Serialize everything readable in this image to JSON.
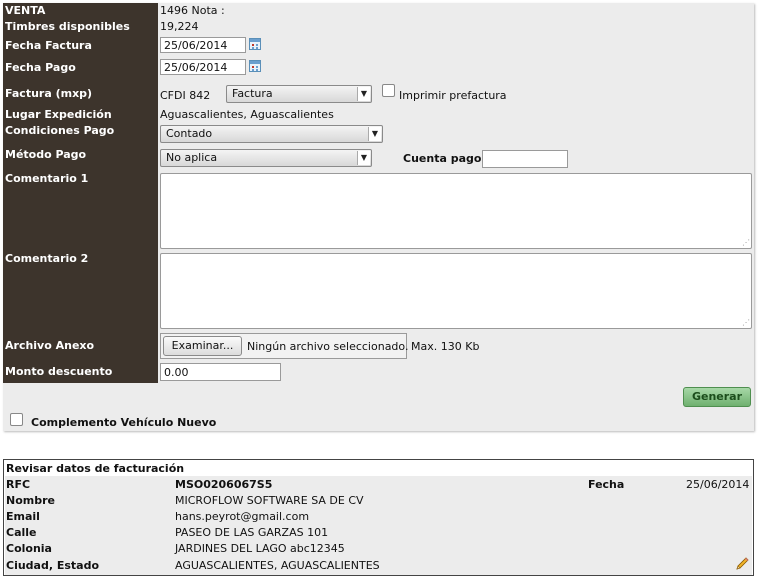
{
  "form": {
    "venta_label": "VENTA",
    "venta_value": "1496 Nota :",
    "timbres_label": "Timbres disponibles",
    "timbres_value": "19,224",
    "fecha_factura_label": "Fecha Factura",
    "fecha_factura_value": "25/06/2014",
    "fecha_pago_label": "Fecha Pago",
    "fecha_pago_value": "25/06/2014",
    "factura_label": "Factura (mxp)",
    "factura_prefix": "CFDI 842",
    "factura_select": "Factura",
    "imprimir_label": "Imprimir prefactura",
    "lugar_label": "Lugar Expedición",
    "lugar_value": "Aguascalientes, Aguascalientes",
    "condiciones_label": "Condiciones Pago",
    "condiciones_select": "Contado",
    "metodo_label": "Método Pago",
    "metodo_select": "No aplica",
    "cuenta_label": "Cuenta pago",
    "cuenta_value": "",
    "comentario1_label": "Comentario 1",
    "comentario2_label": "Comentario 2",
    "archivo_label": "Archivo Anexo",
    "examinar_label": "Examinar...",
    "archivo_status": "Ningún archivo seleccionado.",
    "archivo_max": "Max. 130 Kb",
    "monto_label": "Monto descuento",
    "monto_value": "0.00",
    "generar_label": "Generar",
    "complemento_label": "Complemento Vehículo Nuevo"
  },
  "review": {
    "title": "Revisar datos de facturación",
    "rfc_label": "RFC",
    "rfc_value": "MSO0206067S5",
    "fecha_label": "Fecha",
    "fecha_value": "25/06/2014",
    "nombre_label": "Nombre",
    "nombre_value": "MICROFLOW SOFTWARE SA DE CV",
    "email_label": "Email",
    "email_value": "hans.peyrot@gmail.com",
    "calle_label": "Calle",
    "calle_value": "PASEO DE LAS GARZAS 101",
    "colonia_label": "Colonia",
    "colonia_value": "JARDINES DEL LAGO abc12345",
    "ciudad_label": "Ciudad, Estado",
    "ciudad_value": "AGUASCALIENTES, AGUASCALIENTES",
    "edit_icon": "pencil-icon"
  },
  "colors": {
    "label_column": "#3d342c",
    "panel_bg": "#ececec",
    "generate_button": "#6fb06f"
  }
}
